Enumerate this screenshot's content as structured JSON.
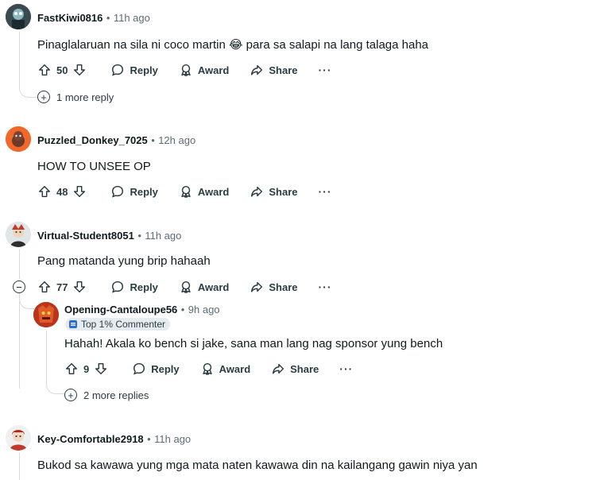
{
  "comments": [
    {
      "author": "FastKiwi0816",
      "time": "11h ago",
      "body": "Pinaglalaruan na sila ni coco martin 😂 para sa salapi na lang talaga haha",
      "score": "50",
      "more_replies": "1 more reply"
    },
    {
      "author": "Puzzled_Donkey_7025",
      "time": "12h ago",
      "body": "HOW TO UNSEE OP",
      "score": "48"
    },
    {
      "author": "Virtual-Student8051",
      "time": "11h ago",
      "body": "Pang matanda yung brip hahaah",
      "score": "77"
    },
    {
      "author": "Opening-Cantaloupe56",
      "time": "9h ago",
      "flair": "Top 1% Commenter",
      "body": "Hahah! Akala ko bench si jake, sana man lang nag sponsor yung bench",
      "score": "9",
      "more_replies": "2 more replies"
    },
    {
      "author": "Key-Comfortable2918",
      "time": "11h ago",
      "body": "Bukod sa kawawa yung mga mata naten kawawa din na kailangang gawin niya yan"
    }
  ],
  "labels": {
    "reply": "Reply",
    "award": "Award",
    "share": "Share",
    "overflow": "···",
    "sep": "•"
  },
  "icons": [
    "upvote-icon",
    "downvote-icon",
    "reply-icon",
    "award-icon",
    "share-icon",
    "expand-icon",
    "collapse-icon"
  ]
}
